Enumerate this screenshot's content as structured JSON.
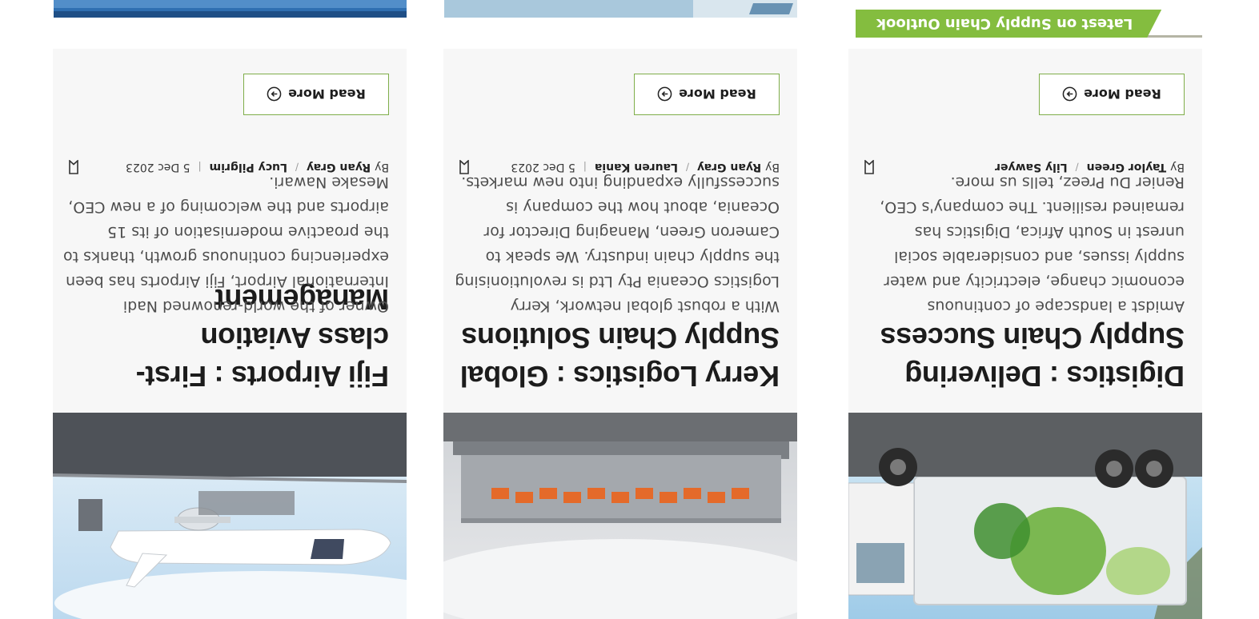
{
  "cards": [
    {
      "title": "Digistics : Delivering Supply Chain Success",
      "excerpt": "Amidst a landscape of continuous economic change, electricity and water supply issues, and considerable social unrest in South Africa, Digistics has remained resilient. The company's CEO, Renier Du Preez, tells us more.",
      "by": "By",
      "author1": "Taylor Green",
      "author2": "Lily Sawyer",
      "date": "",
      "read_more": "Read More"
    },
    {
      "title": "Kerry Logistics : Global Supply Chain Solutions",
      "excerpt": "With a robust global network, Kerry Logistics Oceania Pty Ltd is revolutionising the supply chain industry. We speak to Cameron Green, Managing Director for Oceania, about how the company is successfully expanding into new markets.",
      "by": "By",
      "author1": "Ryan Gray",
      "author2": "Lauren Kania",
      "date": "5 Dec 2023",
      "read_more": "Read More"
    },
    {
      "title": "Fiji Airports : First-class Aviation Management",
      "excerpt": "Owner of the world-renowned Nadi International Airport, Fiji Airports has been experiencing continuous growth, thanks to the proactive modernisation of its 15 airports and the welcoming of a new CEO, Mesake Nawari.",
      "by": "By",
      "author1": "Ryan Gray",
      "author2": "Lucy Pilgrim",
      "date": "5 Dec 2023",
      "read_more": "Read More"
    }
  ],
  "banner": {
    "label": "Latest on Supply Chain Outlook"
  },
  "colors": {
    "accent": "#84bd3f",
    "card_bg": "#f7f7f7",
    "button_border": "#7fae4a"
  }
}
